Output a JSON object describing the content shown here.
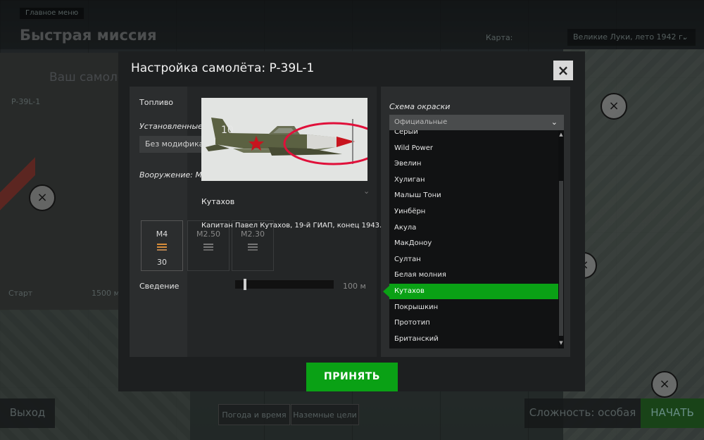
{
  "background": {
    "breadcrumb": "Главное меню",
    "title": "Быстрая миссия",
    "subtitle": "Ваш самолёт",
    "map_label": "Карта:",
    "map_value": "Великие Луки, лето 1942 г.",
    "plane_name": "P-39L-1",
    "start_label": "Старт",
    "start_value": "1500 м",
    "exit_label": "Выход",
    "weather_label": "Погода и время",
    "ground_label": "Наземные цели",
    "difficulty_label": "Сложность: особая",
    "start_button": "НАЧАТЬ"
  },
  "modal": {
    "title": "Настройка самолёта: P-39L-1",
    "close": "×",
    "fuel_label": "Топливо",
    "mods_label": "Установленные м",
    "mods_value": "Без модифика",
    "armament_label": "Вооружение: М",
    "convergence_label": "Сведение",
    "convergence_value": "100 м",
    "weapons": [
      {
        "name": "M4",
        "count": "30"
      },
      {
        "name": "M2.50",
        "count": ""
      },
      {
        "name": "M2.30",
        "count": ""
      }
    ],
    "preview_tail_number": "10",
    "skin_title": "Кутахов",
    "skin_description": "Капитан Павел Кутахов, 19-й ГИАП, конец 1943.",
    "scheme_label": "Схема окраски",
    "scheme_value": "Официальные",
    "skins": [
      "Серый",
      "Wild Power",
      "Эвелин",
      "Хулиган",
      "Малыш Тони",
      "Уинбёрн",
      "Акула",
      "МакДоноу",
      "Султан",
      "Белая молния",
      "Кутахов",
      "Покрышкин",
      "Прототип",
      "Британский"
    ],
    "selected_index": 10,
    "accept_label": "ПРИНЯТЬ"
  },
  "colors": {
    "accent": "#0aa115",
    "highlight_circle": "#e0103a"
  }
}
